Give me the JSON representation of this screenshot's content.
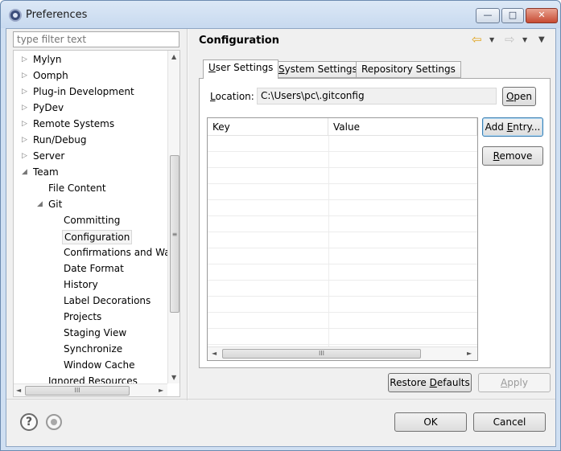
{
  "window": {
    "title": "Preferences",
    "min_glyph": "—",
    "max_glyph": "□",
    "close_glyph": "✕"
  },
  "filter": {
    "placeholder": "type filter text"
  },
  "tree": {
    "items": [
      {
        "label": "Mylyn",
        "twisty": "▷"
      },
      {
        "label": "Oomph",
        "twisty": "▷"
      },
      {
        "label": "Plug-in Development",
        "twisty": "▷"
      },
      {
        "label": "PyDev",
        "twisty": "▷"
      },
      {
        "label": "Remote Systems",
        "twisty": "▷"
      },
      {
        "label": "Run/Debug",
        "twisty": "▷"
      },
      {
        "label": "Server",
        "twisty": "▷"
      },
      {
        "label": "Team",
        "twisty": "◢"
      },
      {
        "label": "File Content",
        "twisty": ""
      },
      {
        "label": "Git",
        "twisty": "◢"
      },
      {
        "label": "Committing",
        "twisty": ""
      },
      {
        "label": "Configuration",
        "twisty": ""
      },
      {
        "label": "Confirmations and Wa",
        "twisty": ""
      },
      {
        "label": "Date Format",
        "twisty": ""
      },
      {
        "label": "History",
        "twisty": ""
      },
      {
        "label": "Label Decorations",
        "twisty": ""
      },
      {
        "label": "Projects",
        "twisty": ""
      },
      {
        "label": "Staging View",
        "twisty": ""
      },
      {
        "label": "Synchronize",
        "twisty": ""
      },
      {
        "label": "Window Cache",
        "twisty": ""
      },
      {
        "label": "Ignored Resources",
        "twisty": ""
      }
    ],
    "selected": "Configuration",
    "scroll_up": "▲",
    "scroll_down": "▼",
    "scroll_left": "◄",
    "scroll_right": "►",
    "thumb_grip": "≡",
    "hthumb_grip": "III"
  },
  "header": {
    "title": "Configuration",
    "back_glyph": "⇦",
    "forward_glyph": "⇨",
    "drop_glyph": "▼",
    "menu_glyph": "▼"
  },
  "tabs": [
    {
      "label": "User Settings",
      "mnemonic": "U",
      "rest": "ser Settings",
      "active": true
    },
    {
      "label": "System Settings",
      "mnemonic": "S",
      "rest": "ystem Settings",
      "active": false
    },
    {
      "label": "Repository Settings",
      "mnemonic": "",
      "rest": "Repository Settings",
      "active": false
    }
  ],
  "location": {
    "label_mn": "L",
    "label_rest": "ocation:",
    "value": "C:\\Users\\pc\\.gitconfig",
    "open_mn": "O",
    "open_rest": "pen"
  },
  "table": {
    "columns": [
      "Key",
      "Value"
    ],
    "rows": [],
    "scroll_left": "◄",
    "scroll_right": "►",
    "thumb_grip": "III"
  },
  "buttons": {
    "add_entry_pre": "Add ",
    "add_entry_mn": "E",
    "add_entry_post": "ntry...",
    "remove_mn": "R",
    "remove_rest": "emove",
    "restore_pre": "Restore ",
    "restore_mn": "D",
    "restore_post": "efaults",
    "apply_mn": "A",
    "apply_rest": "pply",
    "ok": "OK",
    "cancel": "Cancel"
  },
  "footer": {
    "help_glyph": "?"
  }
}
